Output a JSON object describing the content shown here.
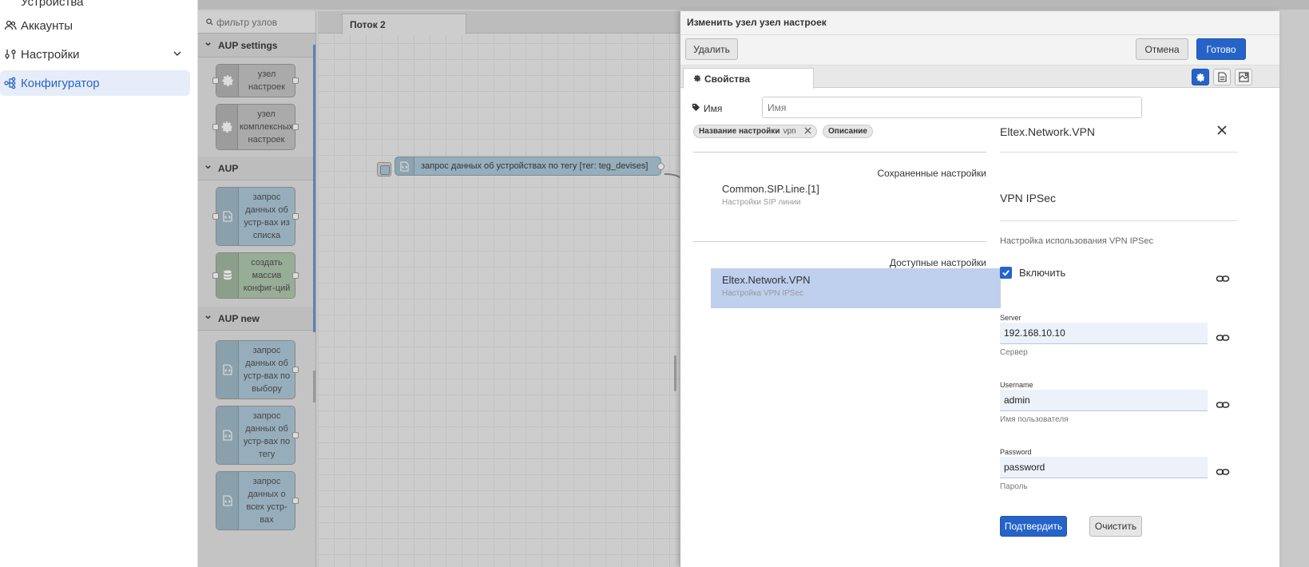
{
  "sidebar": {
    "items": [
      {
        "label": "Устройства"
      },
      {
        "label": "Аккаунты"
      },
      {
        "label": "Настройки"
      },
      {
        "label": "Конфигуратор"
      }
    ]
  },
  "palette": {
    "search_placeholder": "фильтр узлов",
    "categories": [
      {
        "title": "AUP settings",
        "nodes": [
          "узел настроек",
          "узел комплексных настроек"
        ]
      },
      {
        "title": "AUP",
        "nodes": [
          "запрос данных об устр-вах из списка",
          "создать массив конфиг-ций"
        ]
      },
      {
        "title": "AUP new",
        "nodes": [
          "запрос данных об устр-вах по выбору",
          "запрос данных об устр-вах по тегу",
          "запрос данных о всех устр-вах"
        ]
      }
    ]
  },
  "workspace": {
    "tab": "Поток 2",
    "node_label": "запрос данных об устройствах по тегу [тег: teg_devises]"
  },
  "tray": {
    "title": "Изменить узел узел настроек",
    "delete_label": "Удалить",
    "cancel_label": "Отмена",
    "done_label": "Готово",
    "tab_properties": "Свойства",
    "name_label": "Имя",
    "name_placeholder": "Имя",
    "chip_setting_name": "Название настройки",
    "chip_setting_value": "vpn",
    "chip_description": "Описание",
    "saved_title": "Сохраненные настройки",
    "saved_items": [
      {
        "title": "Common.SIP.Line.[1]",
        "subtitle": "Настройки SIP линии"
      }
    ],
    "available_title": "Доступные настройки",
    "available_items": [
      {
        "title": "Eltex.Network.VPN",
        "subtitle": "Настройка VPN IPSec"
      }
    ],
    "detail": {
      "name": "Eltex.Network.VPN",
      "group_title": "VPN IPSec",
      "group_desc": "Настройка использования VPN IPSec",
      "enable_label": "Включить",
      "fields": [
        {
          "label": "Server",
          "value": "192.168.10.10",
          "hint": "Сервер"
        },
        {
          "label": "Username",
          "value": "admin",
          "hint": "Имя пользователя"
        },
        {
          "label": "Password",
          "value": "password",
          "hint": "Пароль"
        }
      ],
      "confirm_label": "Подтвердить",
      "clear_label": "Очистить"
    }
  },
  "colors": {
    "accent": "#2563c9",
    "selected_bg": "#bfcfee",
    "active_nav": "#2962c9"
  }
}
